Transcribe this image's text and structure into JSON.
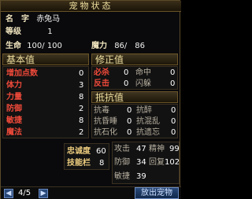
{
  "window": {
    "title": "宠物状态"
  },
  "pet": {
    "name_label": "名　字",
    "name": "赤兔马",
    "level_label": "等级",
    "level": "1",
    "hp_label": "生命",
    "hp": "100/ 100",
    "mp_label": "魔力",
    "mp": "86/　86"
  },
  "base": {
    "title": "基本值",
    "rows": [
      {
        "label": "增加点数",
        "value": "0"
      },
      {
        "label": "体力",
        "value": "3"
      },
      {
        "label": "力量",
        "value": "8"
      },
      {
        "label": "防御",
        "value": "2"
      },
      {
        "label": "敏捷",
        "value": "8"
      },
      {
        "label": "魔法",
        "value": "2"
      }
    ]
  },
  "correction": {
    "title": "修正值",
    "rows": [
      {
        "l1": "必杀",
        "v1": "0",
        "l2": "命中",
        "v2": "0"
      },
      {
        "l1": "反击",
        "v1": "0",
        "l2": "闪躲",
        "v2": "0"
      }
    ]
  },
  "resist": {
    "title": "抵抗值",
    "rows": [
      {
        "l1": "抗毒",
        "v1": "0",
        "l2": "抗醉",
        "v2": "0"
      },
      {
        "l1": "抗昏睡",
        "v1": "0",
        "l2": "抗混乱",
        "v2": "0"
      },
      {
        "l1": "抗石化",
        "v1": "0",
        "l2": "抗遗忘",
        "v2": "0"
      }
    ]
  },
  "extra": {
    "loyalty_label": "忠诚度",
    "loyalty": "60",
    "skill_label": "技能栏",
    "skill": "8"
  },
  "combat": {
    "attack_label": "攻击",
    "attack": "47",
    "spirit_label": "精神",
    "spirit": "99",
    "defense_label": "防御",
    "defense": "34",
    "recover_label": "回复",
    "recover": "102",
    "agility_label": "敏捷",
    "agility": "39"
  },
  "footer": {
    "prev": "◀",
    "next": "▶",
    "page": "4/5",
    "release_label": "放出宠物"
  },
  "colors": {
    "highlight": "#f04a3a",
    "frame": "#6a5428",
    "button": "#2a4a7a"
  }
}
